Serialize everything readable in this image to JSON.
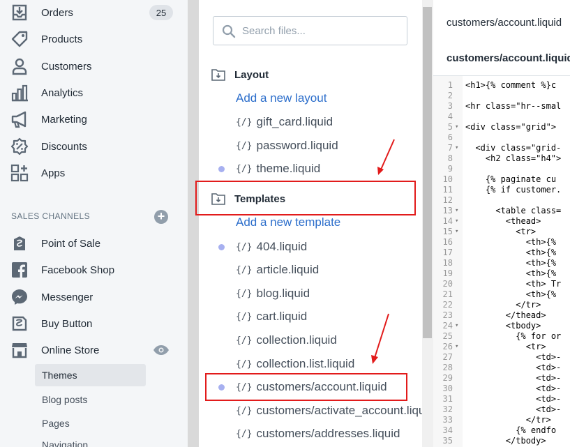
{
  "sidebar": {
    "nav": [
      {
        "label": "Orders",
        "icon": "orders-icon",
        "badge": "25"
      },
      {
        "label": "Products",
        "icon": "products-tag-icon"
      },
      {
        "label": "Customers",
        "icon": "customers-person-icon"
      },
      {
        "label": "Analytics",
        "icon": "analytics-bars-icon"
      },
      {
        "label": "Marketing",
        "icon": "marketing-megaphone-icon"
      },
      {
        "label": "Discounts",
        "icon": "discounts-badge-icon"
      },
      {
        "label": "Apps",
        "icon": "apps-grid-icon"
      }
    ],
    "sales_channels_heading": "SALES CHANNELS",
    "channels": [
      {
        "label": "Point of Sale",
        "icon": "point-of-sale-icon"
      },
      {
        "label": "Facebook Shop",
        "icon": "facebook-icon"
      },
      {
        "label": "Messenger",
        "icon": "messenger-icon"
      },
      {
        "label": "Buy Button",
        "icon": "buy-button-icon"
      },
      {
        "label": "Online Store",
        "icon": "online-store-icon"
      }
    ],
    "online_store_sub": [
      "Themes",
      "Blog posts",
      "Pages",
      "Navigation"
    ]
  },
  "files": {
    "search_placeholder": "Search files...",
    "layout": {
      "label": "Layout",
      "add_link": "Add a new layout",
      "items": [
        {
          "label": "gift_card.liquid",
          "modified": false
        },
        {
          "label": "password.liquid",
          "modified": false
        },
        {
          "label": "theme.liquid",
          "modified": true
        }
      ]
    },
    "templates": {
      "label": "Templates",
      "add_link": "Add a new template",
      "items": [
        {
          "label": "404.liquid",
          "modified": true
        },
        {
          "label": "article.liquid",
          "modified": false
        },
        {
          "label": "blog.liquid",
          "modified": false
        },
        {
          "label": "cart.liquid",
          "modified": false
        },
        {
          "label": "collection.liquid",
          "modified": false
        },
        {
          "label": "collection.list.liquid",
          "modified": false
        },
        {
          "label": "customers/account.liquid",
          "modified": true
        },
        {
          "label": "customers/activate_account.liquid",
          "modified": false
        },
        {
          "label": "customers/addresses.liquid",
          "modified": false
        }
      ]
    },
    "liquid_icon_glyph": "{/}"
  },
  "editor": {
    "tab_label": "customers/account.liquid",
    "file_title": "customers/account.liquid",
    "lines": [
      {
        "n": "1",
        "fold": "",
        "code": "<h1>{% comment %}c"
      },
      {
        "n": "2",
        "fold": "",
        "code": ""
      },
      {
        "n": "3",
        "fold": "",
        "code": "<hr class=\"hr--smal"
      },
      {
        "n": "4",
        "fold": "",
        "code": ""
      },
      {
        "n": "5",
        "fold": "▾",
        "code": "<div class=\"grid\">"
      },
      {
        "n": "6",
        "fold": "",
        "code": ""
      },
      {
        "n": "7",
        "fold": "▾",
        "code": "  <div class=\"grid-"
      },
      {
        "n": "8",
        "fold": "",
        "code": "    <h2 class=\"h4\">"
      },
      {
        "n": "9",
        "fold": "",
        "code": ""
      },
      {
        "n": "10",
        "fold": "",
        "code": "    {% paginate cu"
      },
      {
        "n": "11",
        "fold": "",
        "code": "    {% if customer."
      },
      {
        "n": "12",
        "fold": "",
        "code": ""
      },
      {
        "n": "13",
        "fold": "▾",
        "code": "      <table class="
      },
      {
        "n": "14",
        "fold": "▾",
        "code": "        <thead>"
      },
      {
        "n": "15",
        "fold": "▾",
        "code": "          <tr>"
      },
      {
        "n": "16",
        "fold": "",
        "code": "            <th>{%"
      },
      {
        "n": "17",
        "fold": "",
        "code": "            <th>{%"
      },
      {
        "n": "18",
        "fold": "",
        "code": "            <th>{%"
      },
      {
        "n": "19",
        "fold": "",
        "code": "            <th>{%"
      },
      {
        "n": "20",
        "fold": "",
        "code": "            <th> Tr"
      },
      {
        "n": "21",
        "fold": "",
        "code": "            <th>{%"
      },
      {
        "n": "22",
        "fold": "",
        "code": "          </tr>"
      },
      {
        "n": "23",
        "fold": "",
        "code": "        </thead>"
      },
      {
        "n": "24",
        "fold": "▾",
        "code": "        <tbody>"
      },
      {
        "n": "25",
        "fold": "",
        "code": "          {% for or"
      },
      {
        "n": "26",
        "fold": "▾",
        "code": "            <tr>"
      },
      {
        "n": "27",
        "fold": "",
        "code": "              <td>-"
      },
      {
        "n": "28",
        "fold": "",
        "code": "              <td>-"
      },
      {
        "n": "29",
        "fold": "",
        "code": "              <td>-"
      },
      {
        "n": "30",
        "fold": "",
        "code": "              <td>-"
      },
      {
        "n": "31",
        "fold": "",
        "code": "              <td>-"
      },
      {
        "n": "32",
        "fold": "",
        "code": "              <td>-"
      },
      {
        "n": "33",
        "fold": "",
        "code": "            </tr>"
      },
      {
        "n": "34",
        "fold": "",
        "code": "          {% endfo"
      },
      {
        "n": "35",
        "fold": "",
        "code": "        </tbody>"
      }
    ]
  },
  "colors": {
    "accent": "#2c6ecb",
    "highlight": "#e21b1b",
    "modified_dot": "#a7b0f0",
    "sidebar_bg": "#f4f6f8"
  }
}
